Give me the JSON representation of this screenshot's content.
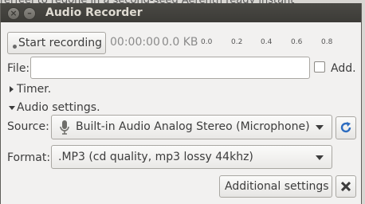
{
  "background": {
    "text": "rerfeel to redone in a second-seed Aerenth ready instant"
  },
  "window": {
    "title": "Audio Recorder",
    "close_glyph": "×",
    "minimize_glyph": "–"
  },
  "record": {
    "button_label": "Start recording",
    "elapsed": "00:00:00",
    "size": "0.0 KB",
    "level_scale": [
      "0.0",
      "0.2",
      "0.4",
      "0.6",
      "0.8"
    ]
  },
  "file": {
    "label": "File:",
    "value": "",
    "add_label": "Add.",
    "add_checked": false
  },
  "timer": {
    "label": "Timer.",
    "expanded": false
  },
  "audio_settings": {
    "label": "Audio settings.",
    "expanded": true,
    "source_label": "Source:",
    "source_value": "Built-in Audio Analog Stereo (Microphone)",
    "format_label": "Format:",
    "format_value": ".MP3  (cd quality, mp3 lossy 44khz)",
    "additional_button": "Additional settings"
  },
  "icons": {
    "close": "close-icon",
    "minimize": "minimize-icon",
    "record_dot": "record-dot-icon",
    "microphone": "microphone-icon",
    "refresh": "refresh-icon",
    "close_settings": "close-x-icon"
  },
  "colors": {
    "titlebar": "#3c3b37",
    "window_bg": "#f2f1f0",
    "refresh_blue": "#2d6cc0"
  }
}
